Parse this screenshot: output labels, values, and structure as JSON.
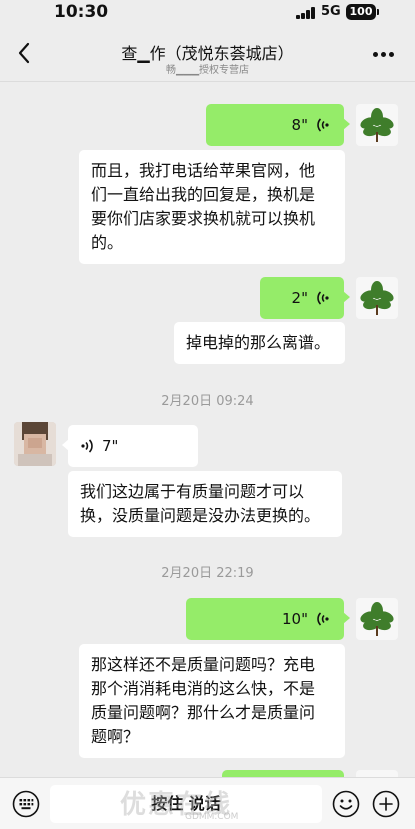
{
  "status_bar": {
    "time": "10:30",
    "network": "5G",
    "battery": "100"
  },
  "nav": {
    "title": "查▁作（茂悦东荟城店）",
    "subtitle": "畅▁▁▁授权专营店"
  },
  "messages": [
    {
      "type": "voice",
      "side": "out",
      "duration": "8\""
    },
    {
      "type": "text",
      "side": "in",
      "lines": [
        "而且，我打电话给苹果官网，他",
        "们一直给出我的回复是，换机是",
        "要你们店家要求换机就可以换机",
        "的。"
      ]
    },
    {
      "type": "voice",
      "side": "out",
      "duration": "2\""
    },
    {
      "type": "text",
      "side": "in",
      "lines": [
        "掉电掉的那么离谱。"
      ]
    },
    {
      "type": "time",
      "text": "2月20日 09:24"
    },
    {
      "type": "voice",
      "side": "in",
      "duration": "7\""
    },
    {
      "type": "text",
      "side": "in",
      "lines": [
        "我们这边属于有质量问题才可以",
        "换，没质量问题是没办法更换的。"
      ]
    },
    {
      "type": "time",
      "text": "2月20日 22:19"
    },
    {
      "type": "voice",
      "side": "out",
      "duration": "10\""
    },
    {
      "type": "text",
      "side": "in",
      "lines": [
        "那这样还不是质量问题吗？充电",
        "那个消消耗电消的这么快，不是",
        "质量问题啊？那什么才是质量问",
        "题啊？"
      ]
    }
  ],
  "input_bar": {
    "hold_to_talk": "按住 说话"
  },
  "watermark": {
    "text": "优惠在线",
    "url": "GDMM.COM"
  },
  "colors": {
    "outgoing_bubble": "#95ec69",
    "incoming_bubble": "#ffffff",
    "background": "#ededed"
  },
  "icons": [
    "back-icon",
    "more-icon",
    "voice-wave-icon",
    "keyboard-icon",
    "emoji-icon",
    "plus-icon"
  ]
}
